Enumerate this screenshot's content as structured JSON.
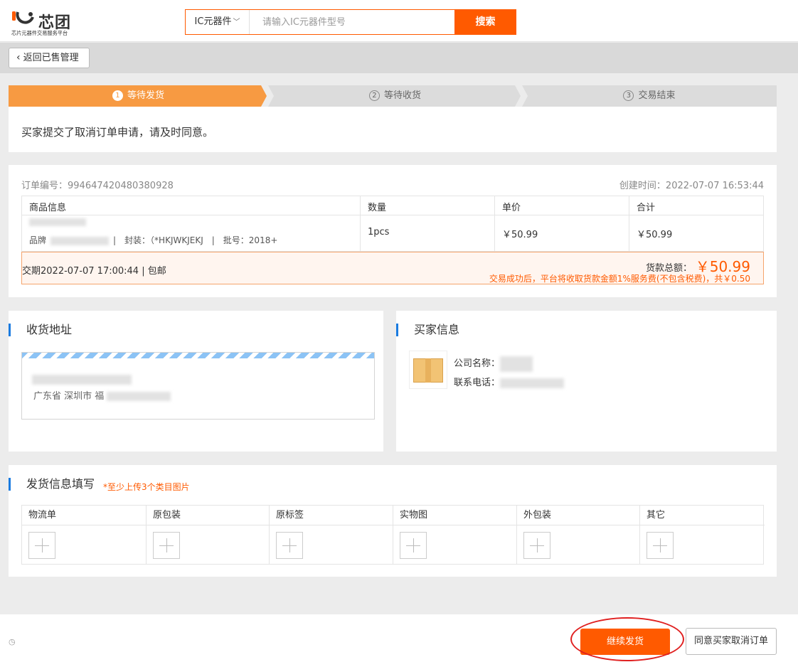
{
  "header": {
    "logo_brand": "芯团",
    "logo_slogan": "芯片元器件交易服务平台",
    "category": "IC元器件",
    "search_placeholder": "请输入IC元器件型号",
    "search_button": "搜索"
  },
  "back_button": "返回已售管理",
  "steps": [
    {
      "num": "1",
      "label": "等待发货",
      "active": true
    },
    {
      "num": "2",
      "label": "等待收货",
      "active": false
    },
    {
      "num": "3",
      "label": "交易结束",
      "active": false
    }
  ],
  "notice": "买家提交了取消订单申请，请及时同意。",
  "order": {
    "number": "订单编号：994647420480380928",
    "created": "创建时间：2022-07-07 16:53:44",
    "columns": [
      "商品信息",
      "数量",
      "单价",
      "合计"
    ],
    "item": {
      "brand_label": "品牌",
      "package_label": "|　封装：（*HKJWKJEKJ　|　批号：2018+",
      "quantity": "1pcs",
      "unit_price": "￥50.99",
      "subtotal": "￥50.99"
    },
    "delivery": "交期2022-07-07 17:00:44 | 包邮",
    "total_label": "货款总额：",
    "total_value": "￥50.99",
    "fee_note": "交易成功后，平台将收取货款金额1%服务费(不包含税费)，共￥0.50"
  },
  "address": {
    "title": "收货地址",
    "line2": "广东省 深圳市 福"
  },
  "buyer": {
    "title": "买家信息",
    "company_label": "公司名称：",
    "phone_label": "联系电话："
  },
  "shipping": {
    "title": "发货信息填写",
    "required_note": "*至少上传3个类目图片",
    "categories": [
      "物流单",
      "原包装",
      "原标签",
      "实物图",
      "外包装",
      "其它"
    ]
  },
  "footer": {
    "history_icon": "clock-icon",
    "continue_button": "继续发货",
    "agree_button": "同意买家取消订单"
  },
  "colors": {
    "accent": "#ff5a00",
    "step_active": "#f79a42",
    "step_inactive": "#dcdcdc",
    "section_bar": "#1a7be0",
    "highlight_ring": "#e02020"
  }
}
